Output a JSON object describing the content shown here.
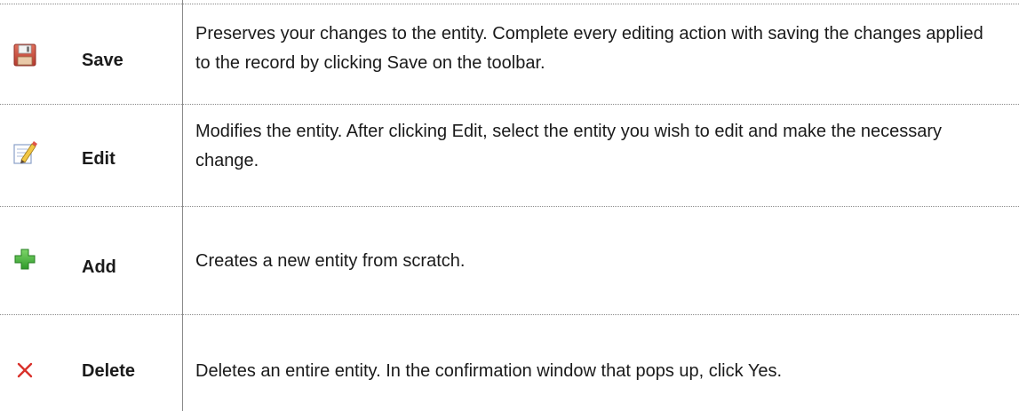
{
  "commands": [
    {
      "icon": "save-icon",
      "label": "Save",
      "description": "Preserves your changes to the entity. Complete every editing action with saving the changes applied to the record by clicking Save on the toolbar."
    },
    {
      "icon": "edit-icon",
      "label": "Edit",
      "description": "Modifies the entity. After clicking Edit, select the entity you wish to edit and make the necessary change."
    },
    {
      "icon": "add-icon",
      "label": "Add",
      "description": "Creates a new entity from scratch."
    },
    {
      "icon": "delete-icon",
      "label": "Delete",
      "description": "Deletes an entire entity. In the confirmation window that pops up, click Yes."
    }
  ],
  "colors": {
    "grid_line": "#8a8a8a",
    "text": "#1a1a1a",
    "add_icon_green": "#3fae3a",
    "delete_icon_red": "#d9312b",
    "save_icon_red": "#c8463a"
  }
}
